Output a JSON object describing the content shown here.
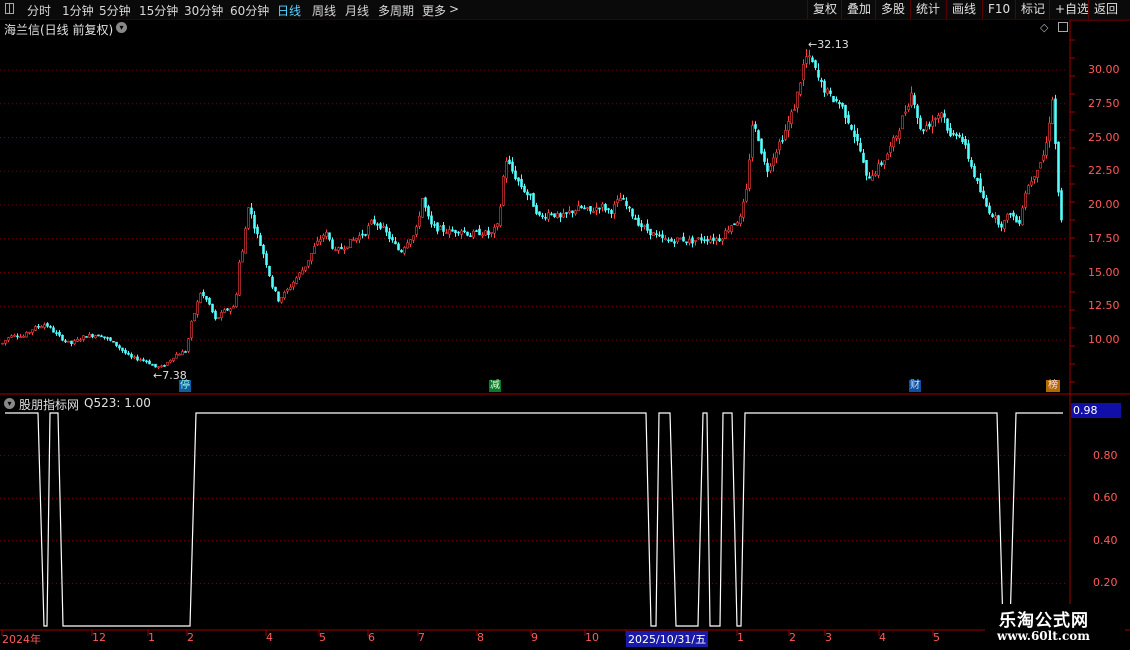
{
  "toolbar": {
    "periods": [
      "分时",
      "1分钟",
      "5分钟",
      "15分钟",
      "30分钟",
      "60分钟",
      "日线",
      "周线",
      "月线",
      "多周期",
      "更多"
    ],
    "active_period": "日线",
    "buttons": [
      "复权",
      "叠加",
      "多股",
      "统计",
      "画线",
      "F10",
      "标记",
      "+自选",
      "返回"
    ]
  },
  "main_panel": {
    "title": "海兰信(日线 前复权)",
    "high_marker": "32.13",
    "low_marker": "7.38",
    "event_markers": [
      {
        "label": "停",
        "color": "#0d5d9f"
      },
      {
        "label": "减",
        "color": "#0d7a2a"
      },
      {
        "label": "财",
        "color": "#0d4fa0"
      },
      {
        "label": "榜",
        "color": "#b06a00"
      }
    ]
  },
  "indicator_panel": {
    "title": "股朋指标网",
    "reading": "Q523: 1.00",
    "current_value": "0.98"
  },
  "x_axis": {
    "labels": [
      "2024年",
      "12",
      "1",
      "2",
      "4",
      "5",
      "6",
      "7",
      "8",
      "9",
      "10",
      "2025/10/31/五",
      "1",
      "2",
      "3",
      "4",
      "5"
    ],
    "highlighted": "2025/10/31/五"
  },
  "watermark": {
    "title": "乐淘公式网",
    "url": "www.60lt.com"
  },
  "colors": {
    "up": "#ff4040",
    "down": "#54ffff",
    "grid": "#7a0000",
    "axis": "#a00000",
    "indicator": "#ffffff"
  },
  "chart_data": [
    {
      "type": "candlestick",
      "title": "海兰信(日线 前复权)",
      "y_ticks": [
        10.0,
        12.5,
        15.0,
        17.5,
        20.0,
        22.5,
        25.0,
        27.5,
        30.0
      ],
      "y_tick_labels": [
        "10.00",
        "12.50",
        "15.00",
        "17.50",
        "20.00",
        "22.50",
        "25.00",
        "27.50",
        "30.00"
      ],
      "ylim": [
        7.0,
        33.5
      ],
      "series": [
        {
          "name": "close_trend",
          "points": [
            [
              0,
              9.6
            ],
            [
              12,
              10.5
            ],
            [
              22,
              10.2
            ],
            [
              32,
              10.8
            ],
            [
              45,
              11.2
            ],
            [
              58,
              10.3
            ],
            [
              70,
              9.7
            ],
            [
              85,
              10.3
            ],
            [
              100,
              10.4
            ],
            [
              115,
              9.7
            ],
            [
              130,
              8.7
            ],
            [
              145,
              8.5
            ],
            [
              155,
              8.0
            ],
            [
              162,
              8.0
            ],
            [
              175,
              8.9
            ],
            [
              186,
              9.2
            ],
            [
              190,
              11.0
            ],
            [
              200,
              13.5
            ],
            [
              208,
              12.8
            ],
            [
              215,
              11.5
            ],
            [
              225,
              12.2
            ],
            [
              235,
              12.5
            ],
            [
              238,
              15.5
            ],
            [
              242,
              16.5
            ],
            [
              248,
              20.0
            ],
            [
              252,
              19.0
            ],
            [
              258,
              17.5
            ],
            [
              265,
              16.0
            ],
            [
              272,
              14.0
            ],
            [
              278,
              13.0
            ],
            [
              285,
              13.5
            ],
            [
              295,
              14.5
            ],
            [
              305,
              15.5
            ],
            [
              315,
              17.0
            ],
            [
              325,
              18.0
            ],
            [
              335,
              16.5
            ],
            [
              345,
              17.0
            ],
            [
              355,
              17.5
            ],
            [
              365,
              18.0
            ],
            [
              372,
              18.8
            ],
            [
              380,
              18.5
            ],
            [
              390,
              17.5
            ],
            [
              400,
              16.5
            ],
            [
              408,
              17.5
            ],
            [
              415,
              17.8
            ],
            [
              422,
              20.5
            ],
            [
              430,
              18.5
            ],
            [
              440,
              18.2
            ],
            [
              450,
              18.0
            ],
            [
              460,
              18.2
            ],
            [
              470,
              17.8
            ],
            [
              480,
              18.0
            ],
            [
              490,
              17.8
            ],
            [
              498,
              18.5
            ],
            [
              505,
              23.5
            ],
            [
              512,
              22.5
            ],
            [
              520,
              21.5
            ],
            [
              530,
              20.5
            ],
            [
              540,
              19.0
            ],
            [
              550,
              19.5
            ],
            [
              560,
              19.0
            ],
            [
              570,
              19.5
            ],
            [
              580,
              19.8
            ],
            [
              590,
              19.5
            ],
            [
              600,
              20.0
            ],
            [
              610,
              19.5
            ],
            [
              620,
              20.5
            ],
            [
              630,
              19.5
            ],
            [
              640,
              18.5
            ],
            [
              650,
              18.0
            ],
            [
              660,
              17.5
            ],
            [
              670,
              17.3
            ],
            [
              680,
              17.5
            ],
            [
              690,
              17.3
            ],
            [
              700,
              17.5
            ],
            [
              710,
              17.5
            ],
            [
              720,
              17.5
            ],
            [
              730,
              18.5
            ],
            [
              740,
              19.0
            ],
            [
              746,
              21.0
            ],
            [
              752,
              26.0
            ],
            [
              758,
              25.0
            ],
            [
              766,
              22.5
            ],
            [
              775,
              24.0
            ],
            [
              785,
              25.5
            ],
            [
              795,
              27.5
            ],
            [
              805,
              31.0
            ],
            [
              812,
              30.5
            ],
            [
              820,
              29.0
            ],
            [
              830,
              28.0
            ],
            [
              840,
              27.5
            ],
            [
              850,
              26.0
            ],
            [
              860,
              24.0
            ],
            [
              866,
              22.0
            ],
            [
              875,
              22.5
            ],
            [
              885,
              23.5
            ],
            [
              895,
              25.0
            ],
            [
              905,
              27.0
            ],
            [
              912,
              28.5
            ],
            [
              920,
              25.5
            ],
            [
              928,
              26.0
            ],
            [
              935,
              26.5
            ],
            [
              942,
              27.0
            ],
            [
              950,
              25.0
            ],
            [
              958,
              25.5
            ],
            [
              966,
              24.0
            ],
            [
              975,
              22.0
            ],
            [
              985,
              20.0
            ],
            [
              995,
              19.0
            ],
            [
              1002,
              18.5
            ],
            [
              1010,
              19.5
            ],
            [
              1018,
              18.5
            ],
            [
              1025,
              21.0
            ],
            [
              1035,
              22.5
            ],
            [
              1045,
              24.0
            ],
            [
              1052,
              28.0
            ],
            [
              1058,
              21.0
            ],
            [
              1063,
              17.2
            ]
          ]
        }
      ]
    },
    {
      "type": "line",
      "title": "股朋指标网",
      "y_ticks": [
        0.2,
        0.4,
        0.6,
        0.8
      ],
      "y_tick_labels": [
        "0.20",
        "0.40",
        "0.60",
        "0.80"
      ],
      "ylim": [
        -0.02,
        1.06
      ],
      "series": [
        {
          "name": "Q523",
          "points": [
            [
              5,
              1
            ],
            [
              38,
              1
            ],
            [
              44,
              0
            ],
            [
              47,
              0
            ],
            [
              50,
              1
            ],
            [
              58,
              1
            ],
            [
              63,
              0
            ],
            [
              190,
              0
            ],
            [
              196,
              1
            ],
            [
              646,
              1
            ],
            [
              651,
              0
            ],
            [
              656,
              0
            ],
            [
              659,
              1
            ],
            [
              670,
              1
            ],
            [
              676,
              0
            ],
            [
              698,
              0
            ],
            [
              703,
              1
            ],
            [
              707,
              1
            ],
            [
              710,
              0
            ],
            [
              720,
              0
            ],
            [
              723,
              1
            ],
            [
              732,
              1
            ],
            [
              737,
              0
            ],
            [
              741,
              0
            ],
            [
              745,
              1
            ],
            [
              997,
              1
            ],
            [
              1003,
              0
            ],
            [
              1010,
              0
            ],
            [
              1016,
              1
            ],
            [
              1063,
              1
            ]
          ]
        }
      ]
    }
  ]
}
